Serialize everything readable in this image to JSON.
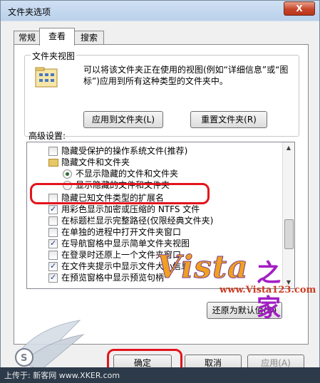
{
  "window": {
    "title": "文件夹选项",
    "close_glyph": "X"
  },
  "tabs": [
    {
      "label": "常规"
    },
    {
      "label": "查看"
    },
    {
      "label": "搜索"
    }
  ],
  "folder_views": {
    "group_label": "文件夹视图",
    "description": "可以将该文件夹正在使用的视图(例如“详细信息”或“图标”)应用到所有这种类型的文件夹中。",
    "apply_button": "应用到文件夹(L)",
    "reset_button": "重置文件夹(R)"
  },
  "advanced": {
    "label": "高级设置:",
    "items": [
      {
        "type": "checkbox",
        "checked": false,
        "label": "隐藏受保护的操作系统文件(推荐)"
      },
      {
        "type": "folder",
        "label": "隐藏文件和文件夹"
      },
      {
        "type": "radio",
        "checked": true,
        "label": "不显示隐藏的文件和文件夹"
      },
      {
        "type": "radio",
        "checked": false,
        "label": "显示隐藏的文件和文件夹"
      },
      {
        "type": "checkbox",
        "checked": false,
        "label": "隐藏已知文件类型的扩展名"
      },
      {
        "type": "checkbox",
        "checked": true,
        "label": "用彩色显示加密或压缩的 NTFS 文件"
      },
      {
        "type": "checkbox",
        "checked": false,
        "label": "在标题栏显示完整路径(仅限经典文件夹)"
      },
      {
        "type": "checkbox",
        "checked": false,
        "label": "在单独的进程中打开文件夹窗口"
      },
      {
        "type": "checkbox",
        "checked": true,
        "label": "在导航窗格中显示简单文件夹视图"
      },
      {
        "type": "checkbox",
        "checked": false,
        "label": "在登录时还原上一个文件夹窗口"
      },
      {
        "type": "checkbox",
        "checked": true,
        "label": "在文件夹提示中显示文件大小信息"
      },
      {
        "type": "checkbox",
        "checked": true,
        "label": "在预览窗格中显示预览句柄"
      }
    ],
    "restore_button": "还原为默认值(D)"
  },
  "footer_buttons": {
    "ok": "确定",
    "cancel": "取消",
    "apply": "应用(A)"
  },
  "watermark": {
    "brand": "Vista",
    "brand_cn": "之家",
    "url": "www.Vista123.com"
  },
  "bottom_strip": {
    "text": "上传于: 新客网 www.XKER.com"
  },
  "colors": {
    "highlight": "#e3141c",
    "title_bar": "#b9d1ea"
  }
}
